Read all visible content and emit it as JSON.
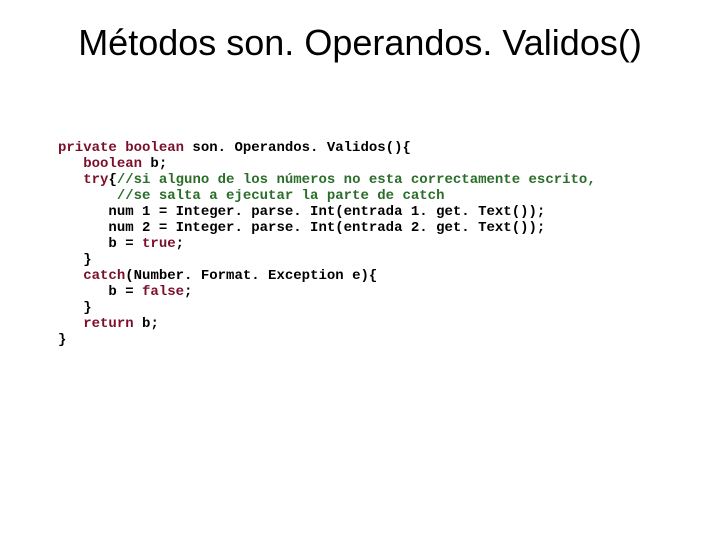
{
  "title": "Métodos son. Operandos. Validos()",
  "code": {
    "l1_kw1": "private",
    "l1_kw2": "boolean",
    "l1_rest": " son. Operandos. Validos(){",
    "l2_kw": "boolean",
    "l2_rest": " b;",
    "l3_kw": "try",
    "l3_brace": "{",
    "l3_cm": "//si alguno de los números no esta correctamente escrito,",
    "l4_cm": "//se salta a ejecutar la parte de catch",
    "l5": "num 1 = Integer. parse. Int(entrada 1. get. Text());",
    "l6": "num 2 = Integer. parse. Int(entrada 2. get. Text());",
    "l7_a": "b = ",
    "l7_kw": "true",
    "l7_b": ";",
    "l8": "}",
    "l9_kw": "catch",
    "l9_rest": "(Number. Format. Exception e){",
    "l10_a": "b = ",
    "l10_kw": "false",
    "l10_b": ";",
    "l11": "}",
    "l12_kw": "return",
    "l12_rest": " b;",
    "l13": "}"
  }
}
